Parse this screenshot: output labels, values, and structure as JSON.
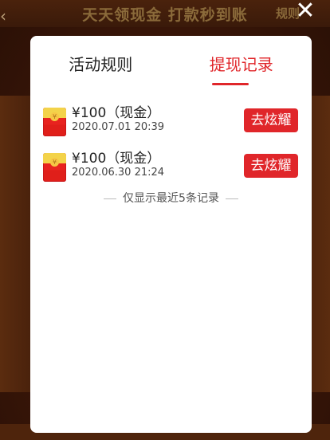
{
  "background": {
    "title": "天天领现金 打款秒到账",
    "right_text": "规则"
  },
  "modal": {
    "tabs": [
      {
        "label": "活动规则",
        "active": false
      },
      {
        "label": "提现记录",
        "active": true
      }
    ],
    "records": [
      {
        "amount": "¥100（现金）",
        "time": "2020.07.01 20:39",
        "button": "去炫耀"
      },
      {
        "amount": "¥100（现金）",
        "time": "2020.06.30 21:24",
        "button": "去炫耀"
      }
    ],
    "note": "仅显示最近5条记录"
  },
  "colors": {
    "accent": "#e0262a",
    "overlay": "#3a1a0e"
  },
  "icons": [
    "back-icon",
    "close-icon",
    "red-envelope-icon"
  ]
}
